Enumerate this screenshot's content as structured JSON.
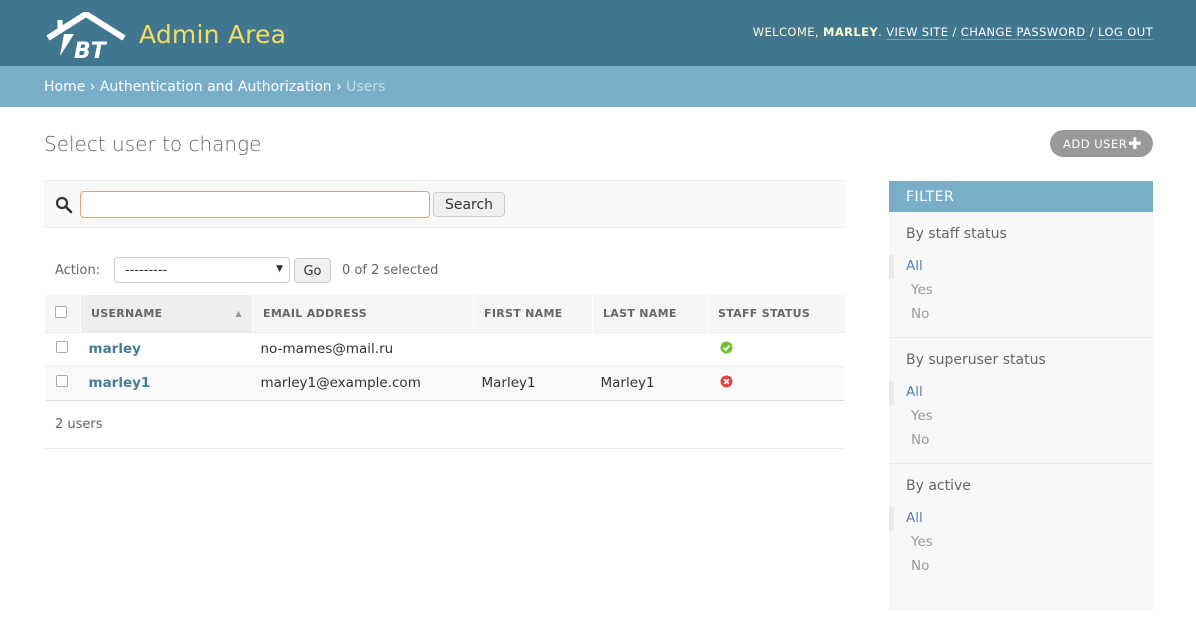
{
  "header": {
    "brand": "Admin Area",
    "logo_text": "BT",
    "welcome": "WELCOME, ",
    "username": "MARLEY",
    "period": ". ",
    "view_site": "VIEW SITE",
    "sep1": " / ",
    "change_password": "CHANGE PASSWORD",
    "sep2": " / ",
    "log_out": "LOG OUT"
  },
  "breadcrumbs": {
    "home": "Home",
    "section": "Authentication and Authorization",
    "current": "Users",
    "separator": "›"
  },
  "page": {
    "title": "Select user to change",
    "add_user": "ADD USER"
  },
  "search": {
    "value": "",
    "button": "Search"
  },
  "actions": {
    "label": "Action:",
    "selected_option": "---------",
    "go": "Go",
    "selected_count": "0 of 2 selected"
  },
  "table": {
    "columns": [
      "USERNAME",
      "EMAIL ADDRESS",
      "FIRST NAME",
      "LAST NAME",
      "STAFF STATUS"
    ],
    "rows": [
      {
        "username": "marley",
        "email": "no-mames@mail.ru",
        "first_name": "",
        "last_name": "",
        "staff": true
      },
      {
        "username": "marley1",
        "email": "marley1@example.com",
        "first_name": "Marley1",
        "last_name": "Marley1",
        "staff": false
      }
    ]
  },
  "paginator": "2 users",
  "filter": {
    "heading": "FILTER",
    "groups": [
      {
        "title": "By staff status",
        "options": [
          "All",
          "Yes",
          "No"
        ]
      },
      {
        "title": "By superuser status",
        "options": [
          "All",
          "Yes",
          "No"
        ]
      },
      {
        "title": "By active",
        "options": [
          "All",
          "Yes",
          "No"
        ]
      }
    ]
  },
  "colors": {
    "header_bg": "#417690",
    "breadcrumb_bg": "#79aec8",
    "brand": "#f5dd5d",
    "link": "#447e9b",
    "true_icon": "#70bf2b",
    "false_icon": "#dd4646"
  }
}
